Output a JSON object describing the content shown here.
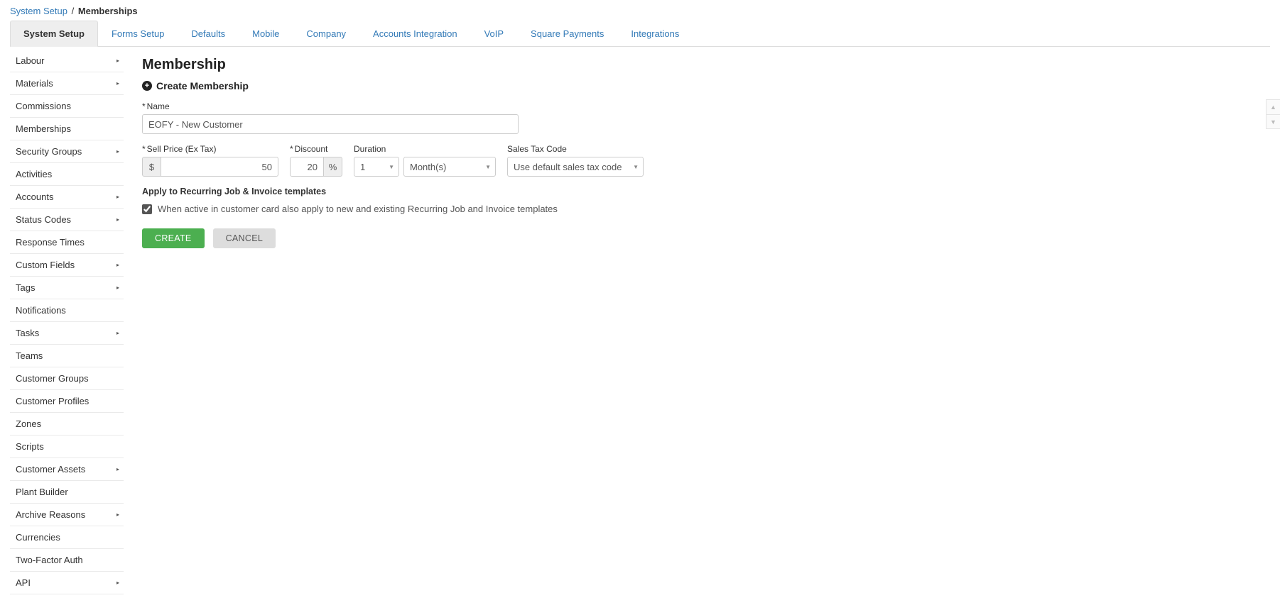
{
  "breadcrumb": {
    "root": "System Setup",
    "sep": "/",
    "current": "Memberships"
  },
  "tabs": [
    {
      "label": "System Setup",
      "active": true
    },
    {
      "label": "Forms Setup"
    },
    {
      "label": "Defaults"
    },
    {
      "label": "Mobile"
    },
    {
      "label": "Company"
    },
    {
      "label": "Accounts Integration"
    },
    {
      "label": "VoIP"
    },
    {
      "label": "Square Payments"
    },
    {
      "label": "Integrations"
    }
  ],
  "sidebar": [
    {
      "label": "Labour",
      "expandable": true
    },
    {
      "label": "Materials",
      "expandable": true
    },
    {
      "label": "Commissions"
    },
    {
      "label": "Memberships"
    },
    {
      "label": "Security Groups",
      "expandable": true
    },
    {
      "label": "Activities"
    },
    {
      "label": "Accounts",
      "expandable": true
    },
    {
      "label": "Status Codes",
      "expandable": true
    },
    {
      "label": "Response Times"
    },
    {
      "label": "Custom Fields",
      "expandable": true
    },
    {
      "label": "Tags",
      "expandable": true
    },
    {
      "label": "Notifications"
    },
    {
      "label": "Tasks",
      "expandable": true
    },
    {
      "label": "Teams"
    },
    {
      "label": "Customer Groups"
    },
    {
      "label": "Customer Profiles"
    },
    {
      "label": "Zones"
    },
    {
      "label": "Scripts"
    },
    {
      "label": "Customer Assets",
      "expandable": true
    },
    {
      "label": "Plant Builder"
    },
    {
      "label": "Archive Reasons",
      "expandable": true
    },
    {
      "label": "Currencies"
    },
    {
      "label": "Two-Factor Auth"
    },
    {
      "label": "API",
      "expandable": true
    }
  ],
  "page": {
    "title": "Membership",
    "section_title": "Create Membership",
    "name_label": "Name",
    "name_value": "EOFY - New Customer",
    "price_label": "Sell Price (Ex Tax)",
    "price_prefix": "$",
    "price_value": "50",
    "discount_label": "Discount",
    "discount_value": "20",
    "discount_suffix": "%",
    "duration_label": "Duration",
    "duration_qty": "1",
    "duration_unit": "Month(s)",
    "tax_label": "Sales Tax Code",
    "tax_value": "Use default sales tax code",
    "recurring_head": "Apply to Recurring Job & Invoice templates",
    "recurring_check_label": "When active in customer card also apply to new and existing Recurring Job and Invoice templates",
    "recurring_checked": true,
    "create_btn": "CREATE",
    "cancel_btn": "CANCEL",
    "req": "*"
  }
}
